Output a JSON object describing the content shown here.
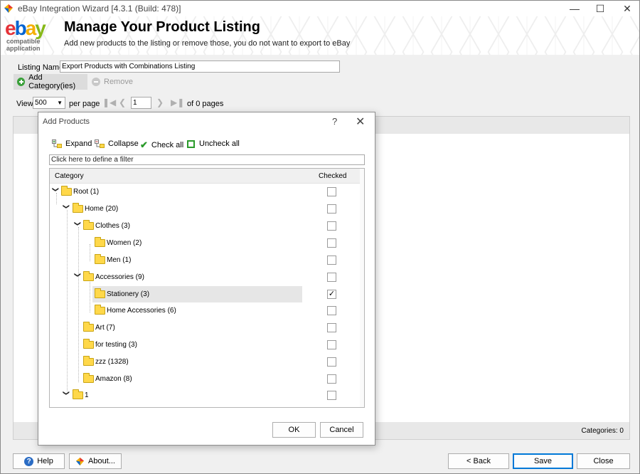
{
  "window": {
    "title": "eBay Integration Wizard [4.3.1 (Build: 478)]",
    "controls": [
      "minimize-icon",
      "maximize-icon",
      "close-icon"
    ]
  },
  "header": {
    "logo_text": "ebay",
    "logo_sub1": "compatible",
    "logo_sub2": "application",
    "title": "Manage Your Product Listing",
    "subtitle": "Add new products to the listing or remove those, you do not want to export to eBay"
  },
  "listing": {
    "label": "Listing Name",
    "value": "Export Products with Combinations Listing"
  },
  "toolbar": {
    "add_label": "Add Category(ies)",
    "remove_label": "Remove"
  },
  "pager": {
    "view_label": "View",
    "per_page_value": "500",
    "per_page_label": "per page",
    "page_value": "1",
    "of_pages_label": "of 0 pages"
  },
  "grid": {
    "count_label": "Categories: 0"
  },
  "dialog": {
    "title": "Add Products",
    "help": "?",
    "close": "✕",
    "toolbar": {
      "expand": "Expand",
      "collapse": "Collapse",
      "check_all": "Check all",
      "uncheck_all": "Uncheck all"
    },
    "filter_placeholder": "Click here to define a filter",
    "columns": [
      "Category",
      "Checked"
    ],
    "rows": [
      {
        "label": "Root (1)",
        "level": 0,
        "expanded": true,
        "checked": false
      },
      {
        "label": "Home (20)",
        "level": 1,
        "expanded": true,
        "checked": false
      },
      {
        "label": "Clothes (3)",
        "level": 2,
        "expanded": true,
        "checked": false
      },
      {
        "label": "Women (2)",
        "level": 3,
        "expanded": false,
        "checked": false
      },
      {
        "label": "Men (1)",
        "level": 3,
        "expanded": false,
        "checked": false
      },
      {
        "label": "Accessories (9)",
        "level": 2,
        "expanded": true,
        "checked": false
      },
      {
        "label": "Stationery (3)",
        "level": 3,
        "expanded": false,
        "checked": true,
        "selected": true
      },
      {
        "label": "Home Accessories (6)",
        "level": 3,
        "expanded": false,
        "checked": false
      },
      {
        "label": "Art (7)",
        "level": 2,
        "expanded": false,
        "checked": false
      },
      {
        "label": "for testing (3)",
        "level": 2,
        "expanded": false,
        "checked": false
      },
      {
        "label": "zzz (1328)",
        "level": 2,
        "expanded": false,
        "checked": false
      },
      {
        "label": "Amazon (8)",
        "level": 2,
        "expanded": false,
        "checked": false
      },
      {
        "label": "1",
        "level": 1,
        "expanded": true,
        "checked": false
      }
    ],
    "ok_label": "OK",
    "cancel_label": "Cancel"
  },
  "footer": {
    "help_label": "Help",
    "about_label": "About...",
    "back_label": "< Back",
    "save_label": "Save",
    "close_label": "Close"
  },
  "colors": {
    "accent_blue": "#0078d7",
    "folder_yellow": "#ffd84a",
    "ebay_red": "#e53238",
    "ebay_blue": "#0064d2",
    "ebay_yellow": "#f5af02",
    "ebay_green": "#86b817"
  }
}
